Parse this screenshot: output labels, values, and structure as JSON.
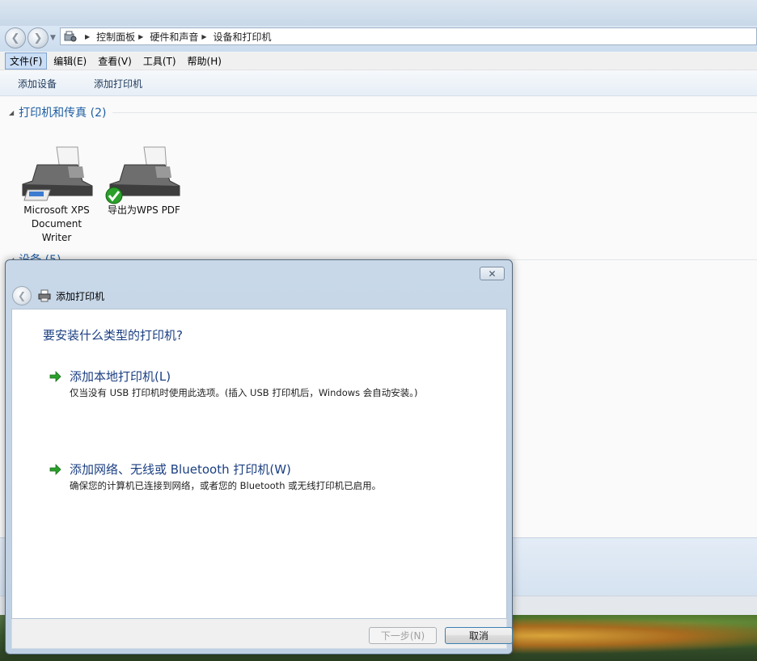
{
  "breadcrumb": [
    "控制面板",
    "硬件和声音",
    "设备和打印机"
  ],
  "menu": [
    "文件(F)",
    "编辑(E)",
    "查看(V)",
    "工具(T)",
    "帮助(H)"
  ],
  "toolbar": {
    "add_device": "添加设备",
    "add_printer": "添加打印机"
  },
  "printers_group": {
    "title": "打印机和传真 (2)",
    "items": [
      {
        "label": "Microsoft XPS Document Writer",
        "default": false
      },
      {
        "label": "导出为WPS PDF",
        "default": true
      }
    ]
  },
  "devices_group": {
    "title": "设备 (5)"
  },
  "dialog": {
    "title": "添加打印机",
    "close_glyph": "✕",
    "heading": "要安装什么类型的打印机?",
    "options": [
      {
        "title": "添加本地打印机(L)",
        "description": "仅当没有 USB 打印机时使用此选项。(插入 USB 打印机后，Windows 会自动安装。)"
      },
      {
        "title": "添加网络、无线或 Bluetooth 打印机(W)",
        "description": "确保您的计算机已连接到网络，或者您的 Bluetooth 或无线打印机已启用。"
      }
    ],
    "next_button": "下一步(N)",
    "cancel_button": "取消"
  },
  "colors": {
    "link_blue": "#1b3f82",
    "group_blue": "#1e5ea3",
    "arrow_green": "#2aa02a"
  },
  "icons": [
    "back-icon",
    "forward-icon",
    "control-panel-icon",
    "printer-icon",
    "default-check-icon",
    "green-arrow-icon"
  ]
}
